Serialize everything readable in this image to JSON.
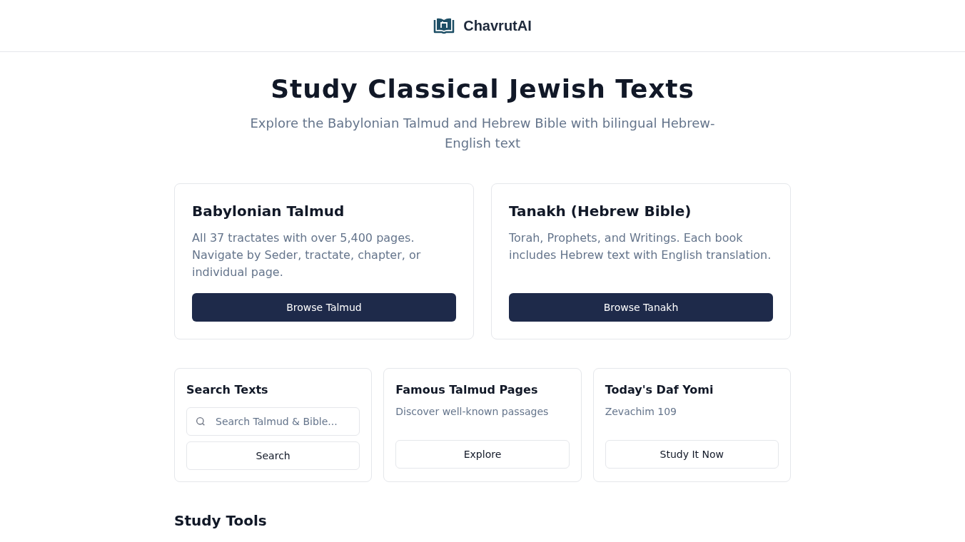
{
  "header": {
    "brand": "ChavrutAI"
  },
  "hero": {
    "title": "Study Classical Jewish Texts",
    "subtitle": "Explore the Babylonian Talmud and Hebrew Bible with bilingual Hebrew-English text"
  },
  "main_cards": [
    {
      "title": "Babylonian Talmud",
      "description": "All 37 tractates with over 5,400 pages. Navigate by Seder, tractate, chapter, or individual page.",
      "button": "Browse Talmud"
    },
    {
      "title": "Tanakh (Hebrew Bible)",
      "description": "Torah, Prophets, and Writings. Each book includes Hebrew text with English translation.",
      "button": "Browse Tanakh"
    }
  ],
  "small_cards": [
    {
      "kind": "search",
      "title": "Search Texts",
      "placeholder": "Search Talmud & Bible...",
      "button": "Search"
    },
    {
      "kind": "info",
      "title": "Famous Talmud Pages",
      "description": "Discover well-known passages",
      "button": "Explore"
    },
    {
      "kind": "info",
      "title": "Today's Daf Yomi",
      "description": "Zevachim 109",
      "button": "Study It Now"
    }
  ],
  "study_tools": {
    "title": "Study Tools"
  }
}
